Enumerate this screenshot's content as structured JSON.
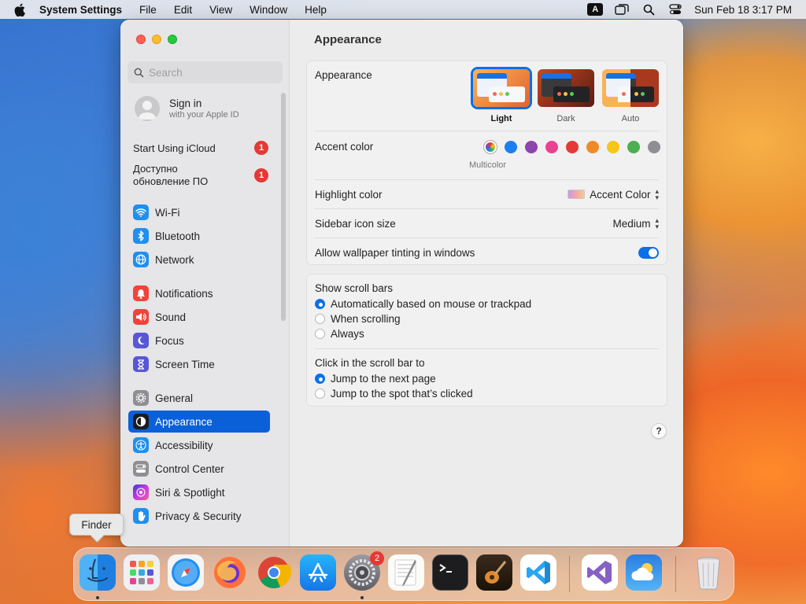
{
  "menubar": {
    "app_name": "System Settings",
    "menus": [
      "File",
      "Edit",
      "View",
      "Window",
      "Help"
    ],
    "input_source": "A",
    "clock": "Sun Feb 18  3:17 PM"
  },
  "sidebar": {
    "search_placeholder": "Search",
    "account": {
      "title": "Sign in",
      "subtitle": "with your Apple ID"
    },
    "notices": [
      {
        "label": "Start Using iCloud",
        "badge": "1"
      },
      {
        "label": "Доступно обновление ПО",
        "badge": "1"
      }
    ],
    "items": [
      {
        "label": "Wi-Fi",
        "icon": "wifi-icon",
        "color": "#1f8ff0"
      },
      {
        "label": "Bluetooth",
        "icon": "bluetooth-icon",
        "color": "#1f8ff0"
      },
      {
        "label": "Network",
        "icon": "globe-icon",
        "color": "#1f8ff0"
      },
      {
        "label": "Notifications",
        "icon": "bell-icon",
        "color": "#f0433a"
      },
      {
        "label": "Sound",
        "icon": "speaker-icon",
        "color": "#f0433a"
      },
      {
        "label": "Focus",
        "icon": "moon-icon",
        "color": "#5856d6"
      },
      {
        "label": "Screen Time",
        "icon": "hourglass-icon",
        "color": "#5856d6"
      },
      {
        "label": "General",
        "icon": "gear-icon",
        "color": "#8e8e93"
      },
      {
        "label": "Appearance",
        "icon": "appearance-icon",
        "color": "#1c1c1e"
      },
      {
        "label": "Accessibility",
        "icon": "accessibility-icon",
        "color": "#1f8ff0"
      },
      {
        "label": "Control Center",
        "icon": "control-center-icon",
        "color": "#8e8e93"
      },
      {
        "label": "Siri & Spotlight",
        "icon": "siri-icon",
        "color": "#c43be0"
      },
      {
        "label": "Privacy & Security",
        "icon": "hand-icon",
        "color": "#1f8ff0"
      }
    ]
  },
  "content": {
    "title": "Appearance",
    "appearance": {
      "label": "Appearance",
      "options": [
        "Light",
        "Dark",
        "Auto"
      ],
      "selected": "Light"
    },
    "accent": {
      "label": "Accent color",
      "colors": [
        "multicolor",
        "#1a7ff0",
        "#8e44ad",
        "#e84393",
        "#e53935",
        "#f08a24",
        "#f5c518",
        "#4caf50",
        "#8e8e93"
      ],
      "selected_label": "Multicolor"
    },
    "highlight": {
      "label": "Highlight color",
      "value": "Accent Color"
    },
    "sidebar_icon_size": {
      "label": "Sidebar icon size",
      "value": "Medium"
    },
    "wallpaper_tinting": {
      "label": "Allow wallpaper tinting in windows",
      "on": true
    },
    "scroll_bars": {
      "label": "Show scroll bars",
      "options": [
        "Automatically based on mouse or trackpad",
        "When scrolling",
        "Always"
      ],
      "selected": 0
    },
    "click_scroll": {
      "label": "Click in the scroll bar to",
      "options": [
        "Jump to the next page",
        "Jump to the spot that’s clicked"
      ],
      "selected": 0
    },
    "help": "?"
  },
  "tooltip": "Finder",
  "dock": {
    "apps": [
      "Finder",
      "Launchpad",
      "Safari",
      "Firefox",
      "Chrome",
      "App Store",
      "System Settings",
      "TextEdit",
      "Terminal",
      "GarageBand",
      "Visual Studio Code",
      "Visual Studio",
      "Weather",
      "Trash"
    ],
    "system_settings_badge": "2"
  }
}
